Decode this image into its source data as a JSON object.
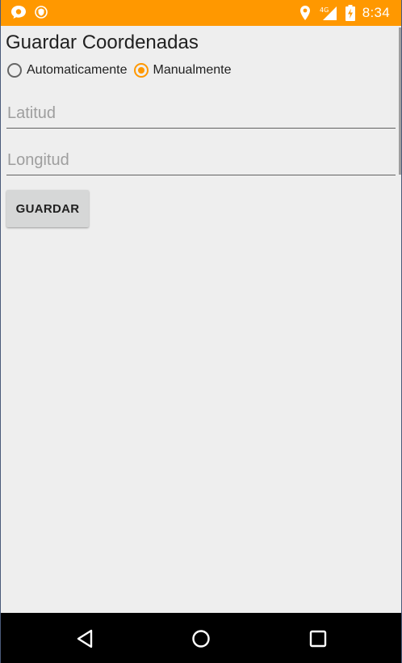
{
  "status_bar": {
    "time": "8:34",
    "network_label": "4G",
    "background_color": "#ff9800",
    "left_icons": [
      "chat-notification-icon",
      "shield-notification-icon"
    ],
    "right_icons": [
      "location-pin-icon",
      "signal-icon",
      "battery-charging-icon"
    ]
  },
  "page": {
    "title": "Guardar Coordenadas"
  },
  "mode": {
    "options": [
      {
        "label": "Automaticamente",
        "checked": false
      },
      {
        "label": "Manualmente",
        "checked": true
      }
    ],
    "accent_color": "#ff9800"
  },
  "form": {
    "latitude": {
      "placeholder": "Latitud",
      "value": ""
    },
    "longitude": {
      "placeholder": "Longitud",
      "value": ""
    },
    "save_label": "GUARDAR"
  },
  "navigation": {
    "buttons": [
      "back-triangle-icon",
      "home-circle-icon",
      "recent-apps-square-icon"
    ]
  }
}
